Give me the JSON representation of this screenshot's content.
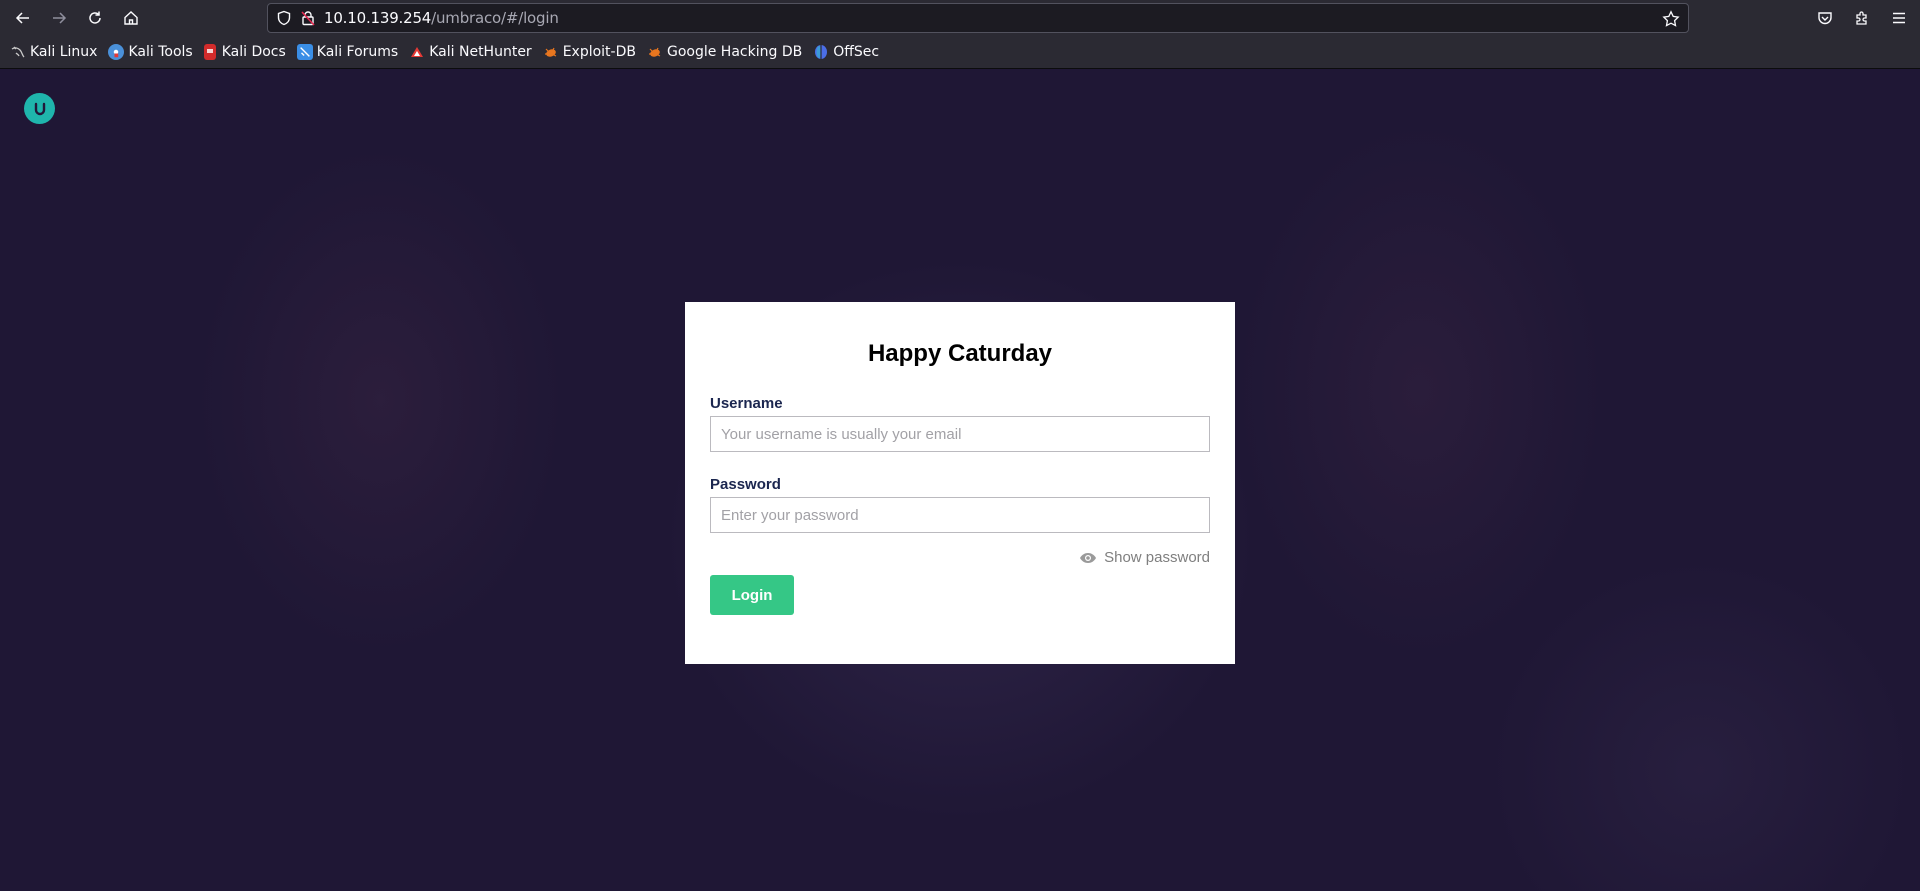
{
  "browser": {
    "url_host": "10.10.139.254",
    "url_path": "/umbraco/#/login",
    "bookmarks": [
      {
        "label": "Kali Linux",
        "icon": "kali-dragon-icon",
        "color": "#c9c9c9"
      },
      {
        "label": "Kali Tools",
        "icon": "kali-tools-icon",
        "color": "#4a90d9"
      },
      {
        "label": "Kali Docs",
        "icon": "kali-docs-icon",
        "color": "#d22b2b"
      },
      {
        "label": "Kali Forums",
        "icon": "kali-forums-icon",
        "color": "#3a8ee6"
      },
      {
        "label": "Kali NetHunter",
        "icon": "kali-nethunter-icon",
        "color": "#e53935"
      },
      {
        "label": "Exploit-DB",
        "icon": "exploit-db-bug-icon",
        "color": "#e8761f"
      },
      {
        "label": "Google Hacking DB",
        "icon": "ghdb-bug-icon",
        "color": "#e8761f"
      },
      {
        "label": "OffSec",
        "icon": "offsec-icon",
        "color": "#4b6ee8"
      }
    ]
  },
  "page": {
    "logo_color": "#1fb5ac",
    "background_color": "#1f1735"
  },
  "login": {
    "title": "Happy Caturday",
    "username_label": "Username",
    "username_value": "",
    "username_placeholder": "Your username is usually your email",
    "password_label": "Password",
    "password_value": "",
    "password_placeholder": "Enter your password",
    "show_password_label": "Show password",
    "login_button_label": "Login",
    "button_color": "#35c786"
  }
}
